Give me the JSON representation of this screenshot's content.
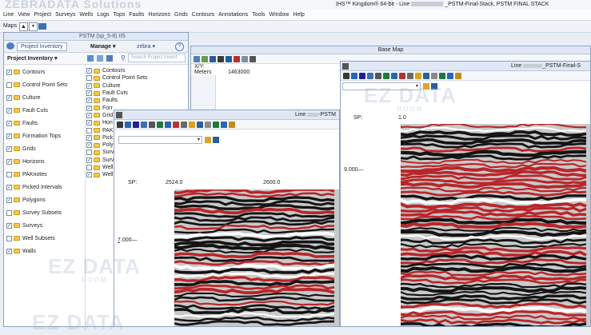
{
  "app_title": "IHS™ Kingdom® 64-bit - Line",
  "app_title_suffix": "_PSTM-Final-Stack, PSTM FINAL STACK",
  "menu": [
    "Line",
    "View",
    "Project",
    "Surveys",
    "Wells",
    "Logs",
    "Tops",
    "Faults",
    "Horizons",
    "Grids",
    "Contours",
    "Annotations",
    "Tools",
    "Window",
    "Help"
  ],
  "maps_label": "Maps",
  "tree_window_title": "PSTM (sp_5-8) IIS",
  "project_inventory_tab": "Project Inventory",
  "manage_button": "Manage ▾",
  "zebra_button": "zebra ▾",
  "project_inventory_dropdown": "Project Inventory ▾",
  "search_placeholder": "Search Project Invent",
  "inventory_items": [
    {
      "label": "Contours",
      "checked": true
    },
    {
      "label": "Control Point Sets",
      "checked": false
    },
    {
      "label": "Culture",
      "checked": true
    },
    {
      "label": "Fault Cuts",
      "checked": true
    },
    {
      "label": "Faults",
      "checked": true
    },
    {
      "label": "Formation Tops",
      "checked": true
    },
    {
      "label": "Grids",
      "checked": true
    },
    {
      "label": "Horizons",
      "checked": true
    },
    {
      "label": "PAKnotes",
      "checked": false
    },
    {
      "label": "Picked Intervals",
      "checked": true
    },
    {
      "label": "Polygons",
      "checked": true
    },
    {
      "label": "Survey Subsets",
      "checked": false
    },
    {
      "label": "Surveys",
      "checked": true
    },
    {
      "label": "Well Subsets",
      "checked": false
    },
    {
      "label": "Walls",
      "checked": true
    }
  ],
  "sub_items": [
    {
      "label": "Contours",
      "checked": true
    },
    {
      "label": "Control Point Sets",
      "checked": false
    },
    {
      "label": "Culture",
      "checked": true
    },
    {
      "label": "Fault Cuts",
      "checked": true
    },
    {
      "label": "Faults",
      "checked": true
    },
    {
      "label": "Forr",
      "checked": true
    },
    {
      "label": "Grid",
      "checked": true
    },
    {
      "label": "Hori",
      "checked": true
    },
    {
      "label": "PAK",
      "checked": false
    },
    {
      "label": "Pick",
      "checked": true
    },
    {
      "label": "Poly",
      "checked": true
    },
    {
      "label": "Surv",
      "checked": false
    },
    {
      "label": "Surv",
      "checked": true
    },
    {
      "label": "Well",
      "checked": false
    },
    {
      "label": "Well",
      "checked": true
    }
  ],
  "ruler_labels": {
    "xy": "X/Y:",
    "meters": "Meters",
    "value": "1463000"
  },
  "base_map_title": "Base Map",
  "line_window_title": "Line",
  "line_window_suffix": "-PSTM",
  "line_sp_label": "SP:",
  "line_sp_values": [
    "2524.0",
    "2600.0"
  ],
  "line_depth_label": "7.000—",
  "right_window_title": "Line",
  "right_window_suffix": "_PSTM-Final-S",
  "right_sp_label": "SP:",
  "right_sp_value": "1.0",
  "right_depth_label": "9.000—",
  "watermark_text": "EZ DATA",
  "watermark_sub": "ROOM",
  "header_watermark": "ZEBRADATA Solutions",
  "colors": {
    "seismic_red": "#b8262a",
    "seismic_dark": "#141414",
    "window_blue": "#dfe8f4",
    "folder": "#f2c94c"
  }
}
